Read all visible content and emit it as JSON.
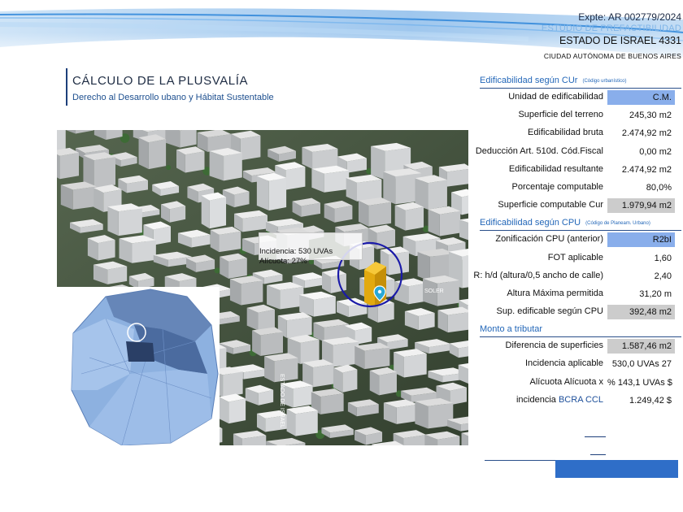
{
  "header": {
    "expediente": "Expte: AR 002779/2024",
    "estudio": "ESTUDIO DE PREFACTIBILIDAD",
    "direccion": "ESTADO DE ISRAEL 4331",
    "ciudad": "CIUDAD AUTÓNOMA DE BUENOS AIRES"
  },
  "title": {
    "main": "CÁLCULO DE LA PLUSVALÍA",
    "sub": "Derecho al Desarrollo ubano y Hábitat Sustentable"
  },
  "map": {
    "callout_line1": "Incidencia: 530 UVAs",
    "callout_line2": "Alícuota: 27%",
    "pin_icon": "location-pin-icon",
    "street_label_1": "ESTADO DE ISRAEL",
    "street_label_2": "SOLER"
  },
  "cur": {
    "title": "Edificabilidad según CUr",
    "note": "(Código urbanístico)",
    "rows": [
      {
        "label": "Unidad de edificabilidad",
        "value": "C.M."
      },
      {
        "label": "Superficie del terreno",
        "value": "245,30 m2"
      },
      {
        "label": "Edificabilidad bruta",
        "value": "2.474,92 m2"
      },
      {
        "label": "Deducción Art. 510d. Cód.Fiscal",
        "value": "0,00 m2"
      },
      {
        "label": "Edificabilidad resultante",
        "value": "2.474,92 m2"
      },
      {
        "label": "Porcentaje computable",
        "value": "80,0%"
      },
      {
        "label": "Superficie computable Cur",
        "value": "1.979,94 m2"
      }
    ]
  },
  "cpu": {
    "title": "Edificabilidad según CPU",
    "note": "(Código de Planeam. Urbano)",
    "rows": [
      {
        "label": "Zonificación CPU (anterior)",
        "value": "R2bI"
      },
      {
        "label": "FOT aplicable",
        "value": "1,60"
      },
      {
        "label": "R: h/d (altura/0,5 ancho de calle)",
        "value": "2,40"
      },
      {
        "label": "Altura Máxima permitida",
        "value": "31,20 m"
      },
      {
        "label": "Sup. edificable según CPU",
        "value": "392,48 m2"
      }
    ]
  },
  "monto": {
    "title": "Monto a tributar",
    "rows": [
      {
        "label": "Diferencia de superficies",
        "value": "1.587,46 m2"
      },
      {
        "label": "Incidencia aplicable",
        "value": "530,0 UVAs 27"
      },
      {
        "label": "Alícuota Alícuota x",
        "value": "% 143,1 UVAs $"
      },
      {
        "label_prefix": "incidencia",
        "label_link": "BCRA CCL",
        "value": "1.249,42 $"
      }
    ]
  },
  "colors": {
    "accent_blue": "#2f6ec8",
    "cell_blue": "#89aeeb",
    "cell_gray": "#cccccc",
    "title_blue": "#2367b8"
  }
}
